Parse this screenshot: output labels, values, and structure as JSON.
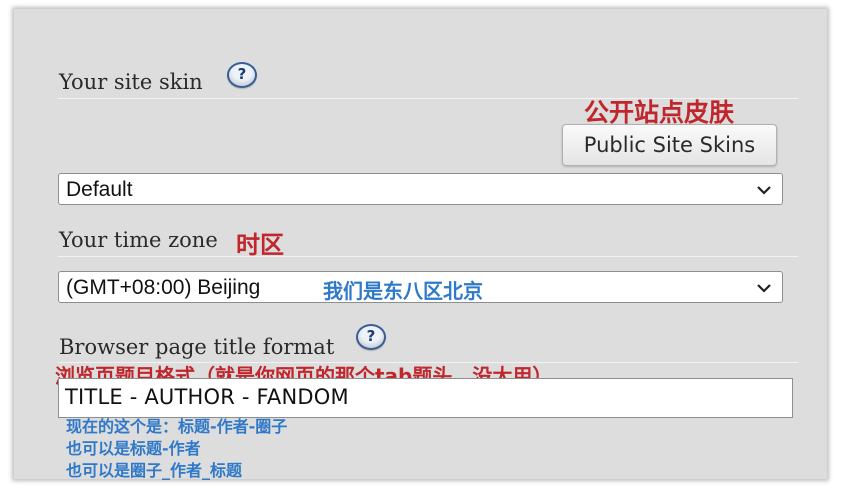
{
  "site_skin": {
    "label": "Your site skin",
    "help": "?",
    "annotation": "公开站点皮肤",
    "button_label": "Public Site Skins",
    "selected": "Default"
  },
  "time_zone": {
    "label": "Your time zone",
    "annotation": "时区",
    "selected": "(GMT+08:00) Beijing",
    "selected_annotation": "我们是东八区北京"
  },
  "title_format": {
    "label": "Browser page title format",
    "help": "?",
    "annotation": "浏览页题目格式（就是你网页的那个tab题头，没大用）",
    "value": "TITLE - AUTHOR - FANDOM",
    "notes": [
      "现在的这个是：标题-作者-圈子",
      "也可以是标题-作者",
      "也可以是圈子_作者_标题"
    ]
  },
  "colors": {
    "annotation_red": "#c0272d",
    "annotation_blue": "#2f79c9",
    "panel_bg": "#dddddd"
  }
}
